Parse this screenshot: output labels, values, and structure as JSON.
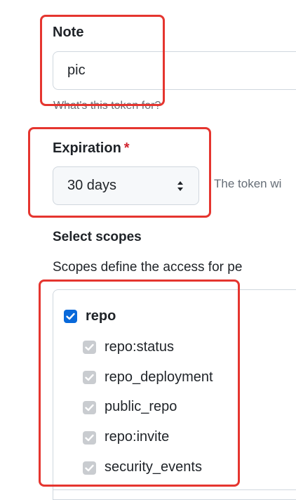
{
  "note": {
    "label": "Note",
    "value": "pic",
    "hint": "What's this token for?"
  },
  "expiration": {
    "label": "Expiration",
    "required_marker": "*",
    "selected": "30 days",
    "hint": "The token wi"
  },
  "scopes": {
    "heading": "Select scopes",
    "description": "Scopes define the access for pe",
    "parent": {
      "name": "repo",
      "checked": true
    },
    "children": [
      {
        "name": "repo:status",
        "checked": true,
        "disabled": true
      },
      {
        "name": "repo_deployment",
        "checked": true,
        "disabled": true
      },
      {
        "name": "public_repo",
        "checked": true,
        "disabled": true
      },
      {
        "name": "repo:invite",
        "checked": true,
        "disabled": true
      },
      {
        "name": "security_events",
        "checked": true,
        "disabled": true
      }
    ]
  },
  "colors": {
    "accent": "#0969da",
    "annotation": "#e5352f",
    "required": "#d1242f"
  }
}
